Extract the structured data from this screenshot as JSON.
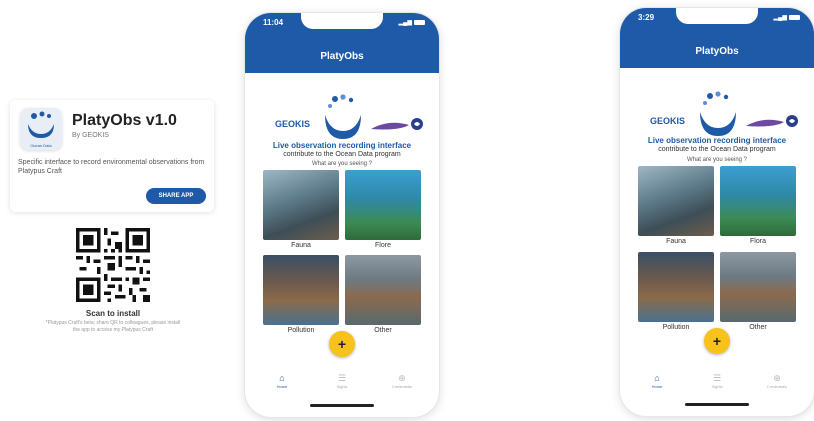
{
  "app_card": {
    "title": "PlatyObs v1.0",
    "by": "By GEOKIS",
    "icon_caption": "Ocean Data",
    "description": "Specific interface to record environmental observations from Platypus Craft",
    "share_label": "SHARE APP"
  },
  "qr": {
    "scan_title": "Scan to install",
    "scan_subtitle": "*Platypus Craft's beta; share QR to colleagues, please install the app to access my Platypus Craft"
  },
  "phones": [
    {
      "time": "11:04",
      "title": "PlatyObs",
      "geokis": "GEOKIS",
      "live_text": "Live observation recording interface",
      "contrib_text": "contribute to the Ocean Data program",
      "seeing_text": "What are you seeing ?",
      "tiles": [
        "Fauna",
        "Flore",
        "Pollution",
        "Other"
      ],
      "fab": "+",
      "nav": [
        "Home",
        "Sights",
        "Credentials"
      ]
    },
    {
      "time": "3:29",
      "title": "PlatyObs",
      "geokis": "GEOKIS",
      "live_text": "Live observation recording interface",
      "contrib_text": "contribute to the Ocean Data program",
      "seeing_text": "What are you seeing ?",
      "tiles": [
        "Fauna",
        "Flora",
        "Pollution",
        "Other"
      ],
      "fab": "+",
      "nav": [
        "Home",
        "Sights",
        "Credentials"
      ]
    }
  ],
  "colors": {
    "primary": "#1f5aa8",
    "fab": "#f6c21b"
  }
}
